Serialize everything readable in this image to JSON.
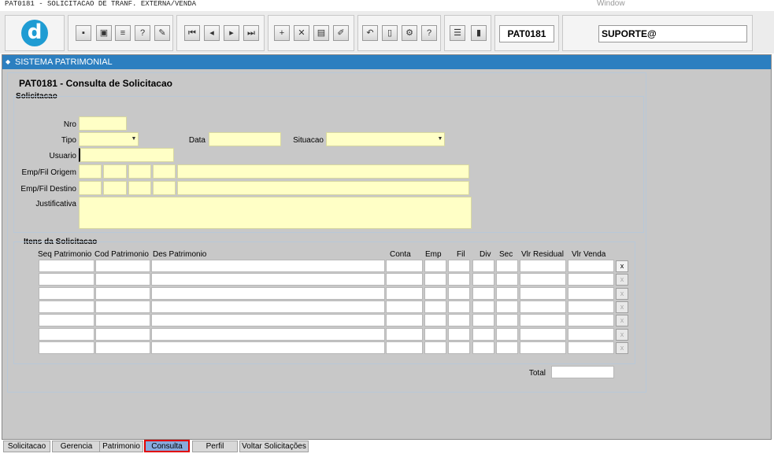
{
  "window": {
    "title": "PAT0181 - SOLICITACAO DE TRANF. EXTERNA/VENDA",
    "menu": "Window"
  },
  "toolbar": {
    "logo_letter": "d",
    "form_code": "PAT0181",
    "user": "SUPORTE@",
    "buttons": [
      {
        "icon": "save-icon",
        "glyph": "▪"
      },
      {
        "icon": "window-icon",
        "glyph": "▣"
      },
      {
        "icon": "print-icon",
        "glyph": "≡"
      },
      {
        "icon": "query-icon",
        "glyph": "?"
      },
      {
        "icon": "execute-query-icon",
        "glyph": "✎"
      },
      {
        "icon": "first-record-icon",
        "glyph": "⏮"
      },
      {
        "icon": "previous-record-icon",
        "glyph": "◂"
      },
      {
        "icon": "next-record-icon",
        "glyph": "▸"
      },
      {
        "icon": "last-record-icon",
        "glyph": "⏭"
      },
      {
        "icon": "insert-record-icon",
        "glyph": "+"
      },
      {
        "icon": "delete-record-icon",
        "glyph": "✕"
      },
      {
        "icon": "lov-icon",
        "glyph": "▤"
      },
      {
        "icon": "edit-icon",
        "glyph": "✐"
      },
      {
        "icon": "undo-icon",
        "glyph": "↶"
      },
      {
        "icon": "clipboard-icon",
        "glyph": "▯"
      },
      {
        "icon": "settings-icon",
        "glyph": "⚙"
      },
      {
        "icon": "help-icon",
        "glyph": "?"
      },
      {
        "icon": "menu-icon",
        "glyph": "☰"
      },
      {
        "icon": "exit-icon",
        "glyph": "▮"
      }
    ]
  },
  "header": {
    "system_title": "SISTEMA PATRIMONIAL",
    "form_title": "PAT0181 - Consulta de Solicitacao"
  },
  "solicitacao": {
    "section_label": "Solicitacao",
    "nro_label": "Nro",
    "tipo_label": "Tipo",
    "data_label": "Data",
    "situacao_label": "Situacao",
    "usuario_label": "Usuario",
    "origem_label": "Emp/Fil Origem",
    "destino_label": "Emp/Fil Destino",
    "justificativa_label": "Justificativa"
  },
  "itens": {
    "section_label": "Itens da Solicitacao",
    "columns": [
      "Seq Patrimonio",
      "Cod Patrimonio",
      "Des Patrimonio",
      "Conta",
      "Emp",
      "Fil",
      "Div",
      "Sec",
      "Vlr Residual",
      "Vlr Venda"
    ],
    "row_count": 7,
    "delete_label": "x",
    "total_label": "Total"
  },
  "tabs": [
    "Solicitacao",
    "Gerencia",
    "Patrimonio",
    "Consulta",
    "Perfil",
    "Voltar Solicitações"
  ],
  "active_tab": "Consulta"
}
